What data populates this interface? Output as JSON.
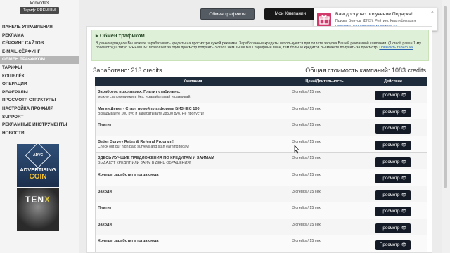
{
  "user": {
    "name": "konvod93",
    "tariff": "Тариф: PREMIUM"
  },
  "sidebar": {
    "items": [
      {
        "label": "ПАНЕЛЬ УПРАВЛЕНИЯ",
        "active": false
      },
      {
        "label": "РЕКЛАМА",
        "active": false
      },
      {
        "label": "СЁРФИНГ САЙТОВ",
        "active": false
      },
      {
        "label": "E-MAIL СЁРФИНГ",
        "active": false
      },
      {
        "label": "ОБМЕН ТРАФИКОМ",
        "active": true
      },
      {
        "label": "ТАРИФЫ",
        "active": false
      },
      {
        "label": "КОШЕЛЁК",
        "active": false
      },
      {
        "label": "ОПЕРАЦИИ",
        "active": false
      },
      {
        "label": "РЕФЕРАЛЫ",
        "active": false
      },
      {
        "label": "ПРОСМОТР СТРУКТУРЫ",
        "active": false
      },
      {
        "label": "НАСТРОЙКА ПРОФИЛЯ",
        "active": false
      },
      {
        "label": "SUPPORT",
        "active": false
      },
      {
        "label": "РЕКЛАМНЫЕ ИНСТРУМЕНТЫ",
        "active": false
      },
      {
        "label": "НОВОСТИ",
        "active": false
      }
    ],
    "banner1": {
      "logo": "ADVC",
      "line1": "ADVERTISING",
      "line2": "COIN"
    },
    "banner2": {
      "text": "TEN",
      "accent": "X"
    }
  },
  "topbar": {
    "exchange_label": "Обмен трафиком",
    "campaigns_label": "Мои Кампании"
  },
  "notification": {
    "title": "Вам доступно получение Подарка!",
    "text": "Призы: Бонусы (BNS), Рейтинг, Квалификация",
    "link": "Получить Подарок прямо сейчас >>",
    "close": "×"
  },
  "info": {
    "title": "Обмен трафиком",
    "body": "В данном разделе Вы можете зарабатывать кредиты на просмотре чужой рекламы. Заработанные кредиты используются при оплате запуска Вашей рекламной кампании. (1 credit равен 1-му просмотру) Статус \"PREMIUM\" позволяет за один просмотр получить 3 credit Чем выше Ваш тарифный план, тем больше кредитов Вы можете получить за просмотр.",
    "link": "Повысить тариф >>"
  },
  "stats": {
    "earned": "Заработано: 213 credits",
    "total_cost": "Общая стоимость кампаний: 1083 credits"
  },
  "table": {
    "headers": [
      "Кампания",
      "Цена/Длительность",
      "Действие"
    ],
    "view_label": "Просмотр",
    "rows": [
      {
        "title": "Заработок в долларах. Платит стабильно.",
        "desc": "можно с вложениями и без, и зарабатывай и развивай.",
        "price": "3 credits / 15 сек."
      },
      {
        "title": "Магия Денег - Старт новой платформы БИЗНЕС 100",
        "desc": "Вкладываете 100 руб и зарабатывате 28500 руб. Не пропусти!",
        "price": "3 credits / 15 сек."
      },
      {
        "title": "Платит",
        "desc": "",
        "price": "3 credits / 15 сек."
      },
      {
        "title": "Better Survey Rates & Referral Program!",
        "desc": "Check out our high paid surveys and start earning today!",
        "price": "3 credits / 15 сек."
      },
      {
        "title": "ЗДЕСЬ ЛУЧШИЕ ПРЕДЛОЖЕНИЯ ПО КРЕДИТАМ И ЗАЙМАМ",
        "desc": "ВЫДАДУТ КРЕДИТ ИЛИ ЗАЙМ В ДЕНЬ ОБРАЩЕНИЯ!",
        "price": "3 credits / 15 сек."
      },
      {
        "title": "Хочешь заработать тогда сюда",
        "desc": "",
        "price": "3 credits / 15 сек."
      },
      {
        "title": "Заходи",
        "desc": "",
        "price": "3 credits / 15 сек."
      },
      {
        "title": "Платит",
        "desc": "",
        "price": "3 credits / 15 сек."
      },
      {
        "title": "Заходи",
        "desc": "",
        "price": "3 credits / 15 сек."
      },
      {
        "title": "Хочешь заработать тогда сюда",
        "desc": "",
        "price": "3 credits / 15 сек."
      }
    ]
  },
  "icons": [
    "gift-icon",
    "eye-icon",
    "close-icon",
    "mouse-cursor-icon"
  ],
  "colors": {
    "header": "#1d2b3a",
    "info_bg": "#dff0d8",
    "gift": "#d23a6b",
    "link": "#2a62b8"
  }
}
